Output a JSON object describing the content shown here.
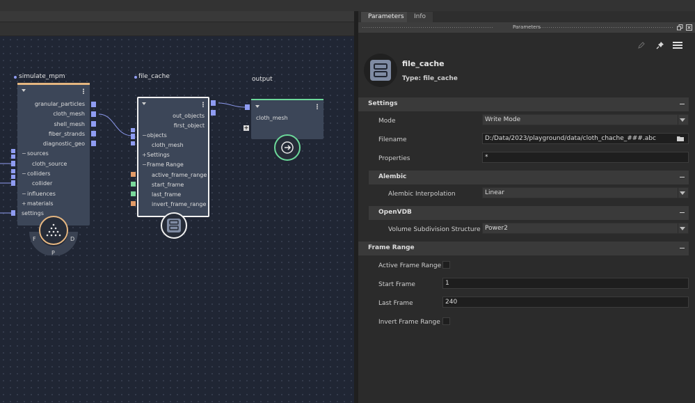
{
  "graph": {
    "nodes": {
      "simulate": {
        "title": "simulate_mpm",
        "outputs": [
          "granular_particles",
          "cloth_mesh",
          "shell_mesh",
          "fiber_strands",
          "diagnostic_geo"
        ],
        "rows": [
          {
            "label": "sources",
            "prefix": "−"
          },
          {
            "label": "cloth_source",
            "prefix": ""
          },
          {
            "label": "colliders",
            "prefix": "−"
          },
          {
            "label": "collider",
            "prefix": ""
          },
          {
            "label": "influences",
            "prefix": "−"
          },
          {
            "label": "materials",
            "prefix": "+"
          },
          {
            "label": "settings",
            "prefix": ""
          }
        ],
        "mode_letters": {
          "left": "F",
          "bottom": "P",
          "right": "D"
        }
      },
      "file_cache": {
        "title": "file_cache",
        "outputs": [
          "out_objects",
          "first_object"
        ],
        "rows": [
          {
            "label": "objects",
            "prefix": "−"
          },
          {
            "label": "cloth_mesh",
            "prefix": ""
          },
          {
            "label": "Settings",
            "prefix": "+"
          },
          {
            "label": "Frame Range",
            "prefix": "−"
          },
          {
            "label": "active_frame_range",
            "prefix": ""
          },
          {
            "label": "start_frame",
            "prefix": ""
          },
          {
            "label": "last_frame",
            "prefix": ""
          },
          {
            "label": "invert_frame_range",
            "prefix": ""
          }
        ]
      },
      "output": {
        "title": "output",
        "inputs": [
          "cloth_mesh"
        ]
      }
    },
    "colors": {
      "canvas": "#202634",
      "node": "#3c4658",
      "port": "#8f9cf2",
      "simulate_accent": "#e5b680",
      "output_accent": "#6cd99a",
      "port_orange": "#e29a66",
      "port_green": "#79d79a"
    }
  },
  "panel": {
    "tabs": [
      "Parameters",
      "Info"
    ],
    "active_tab": "Parameters",
    "header_label": "Parameters",
    "node_name": "file_cache",
    "node_type": "Type: file_cache",
    "sections": {
      "settings": {
        "title": "Settings",
        "mode_label": "Mode",
        "mode_value": "Write Mode",
        "filename_label": "Filename",
        "filename_value": "D:/Data/2023/playground/data/cloth_chache_###.abc",
        "properties_label": "Properties",
        "properties_value": "*"
      },
      "alembic": {
        "title": "Alembic",
        "interp_label": "Alembic Interpolation",
        "interp_value": "Linear"
      },
      "openvdb": {
        "title": "OpenVDB",
        "subdiv_label": "Volume Subdivision Structure",
        "subdiv_value": "Power2"
      },
      "frame_range": {
        "title": "Frame Range",
        "active_label": "Active Frame Range",
        "active_checked": false,
        "start_label": "Start Frame",
        "start_value": "1",
        "last_label": "Last Frame",
        "last_value": "240",
        "invert_label": "Invert Frame Range",
        "invert_checked": false
      }
    }
  }
}
